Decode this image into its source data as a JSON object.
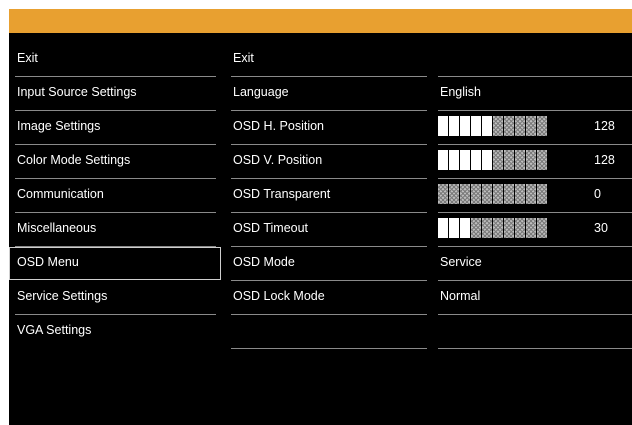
{
  "header_color": "#e8a030",
  "left_menu": [
    "Exit",
    "Input Source Settings",
    "Image Settings",
    "Color Mode Settings",
    "Communication",
    "Miscellaneous",
    "OSD Menu",
    "Service Settings",
    "VGA Settings"
  ],
  "selected_left": "OSD Menu",
  "mid_menu": [
    "Exit",
    "Language",
    "OSD H. Position",
    "OSD V. Position",
    "OSD Transparent",
    "OSD Timeout",
    "OSD Mode",
    "OSD Lock Mode"
  ],
  "values": {
    "language": "English",
    "h_position": {
      "value": "128",
      "bar_filled": 5,
      "bar_total": 10
    },
    "v_position": {
      "value": "128",
      "bar_filled": 5,
      "bar_total": 10
    },
    "transparent": {
      "value": "0",
      "bar_filled": 0,
      "bar_total": 10
    },
    "timeout": {
      "value": "30",
      "bar_filled": 3,
      "bar_total": 10
    },
    "osd_mode": "Service",
    "osd_lock_mode": "Normal"
  }
}
